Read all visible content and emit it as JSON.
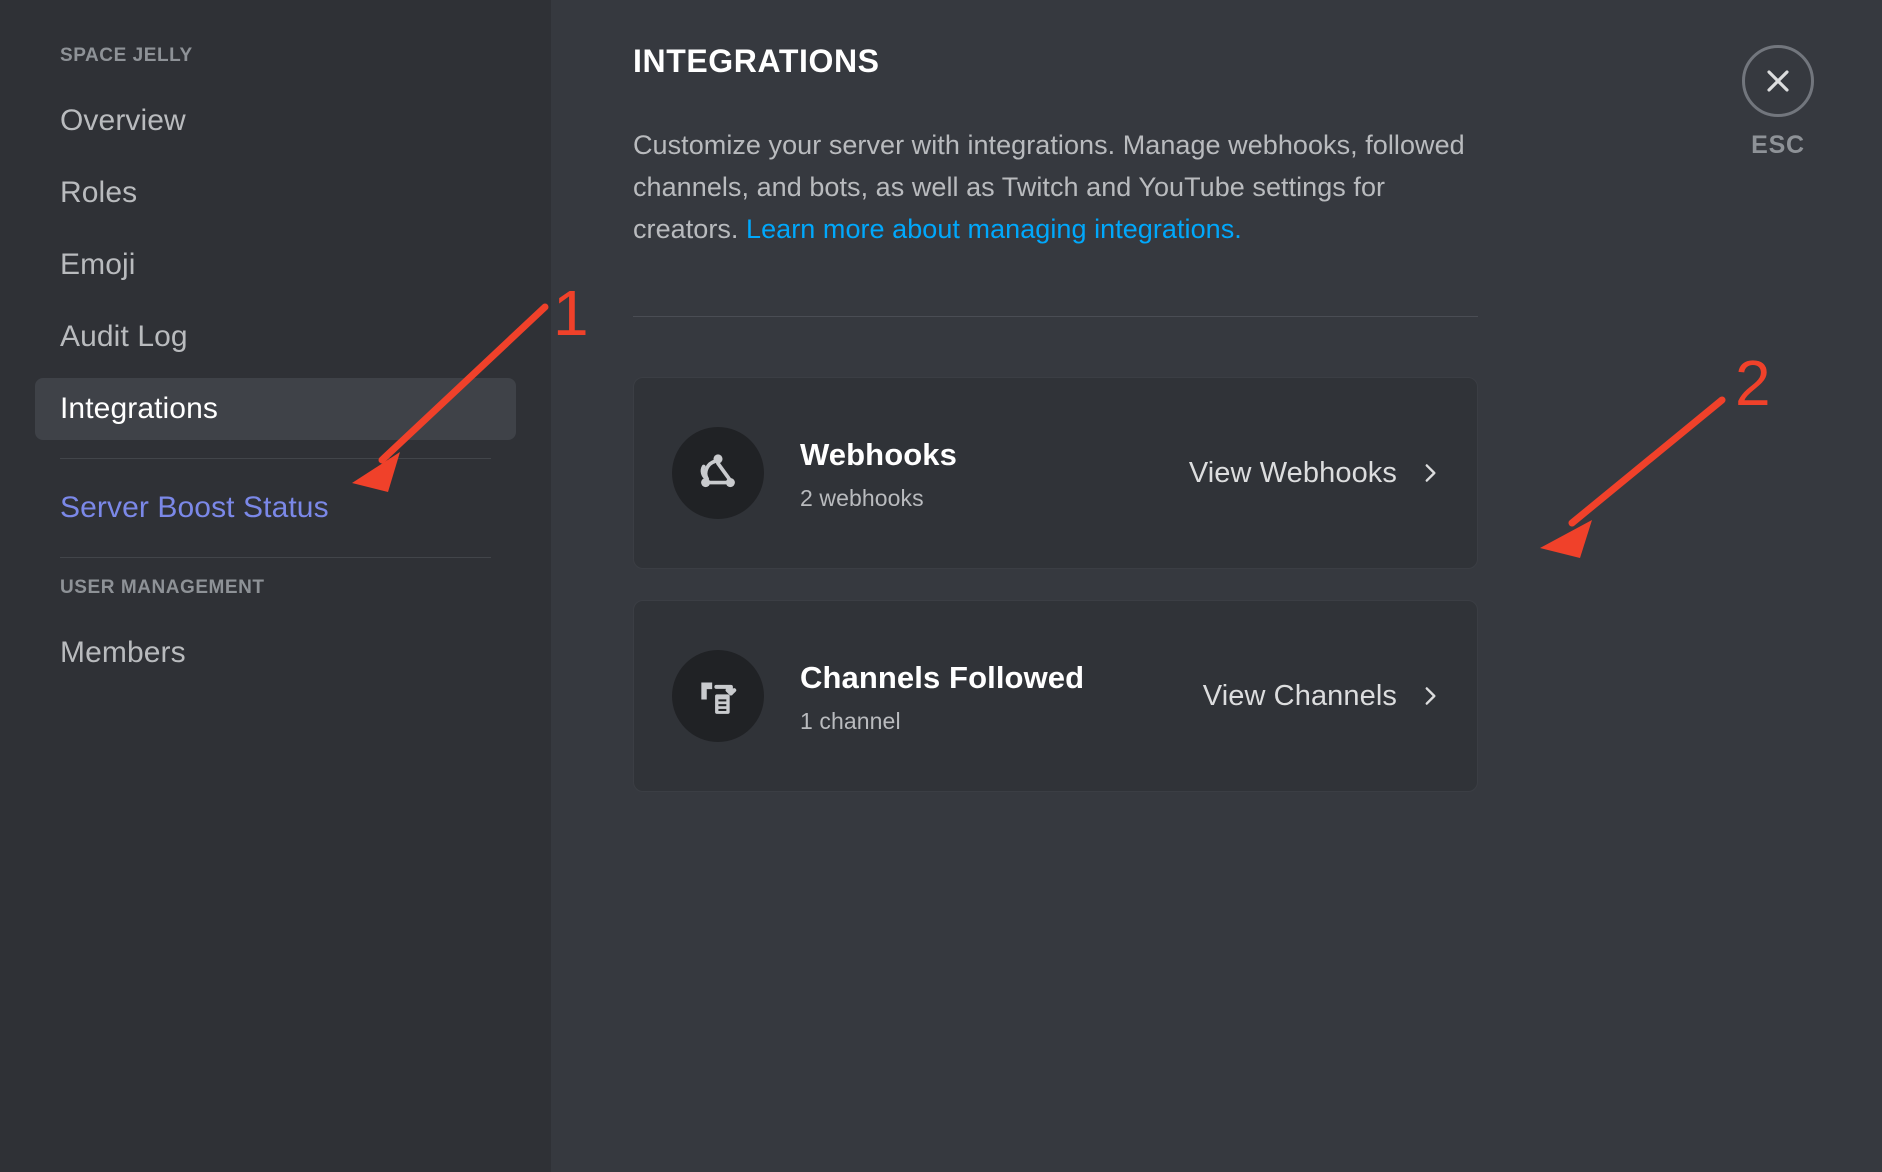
{
  "sidebar": {
    "server_name": "SPACE JELLY",
    "items": [
      {
        "label": "Overview",
        "active": false
      },
      {
        "label": "Roles",
        "active": false
      },
      {
        "label": "Emoji",
        "active": false
      },
      {
        "label": "Audit Log",
        "active": false
      },
      {
        "label": "Integrations",
        "active": true
      }
    ],
    "boost_label": "Server Boost Status",
    "user_management_header": "USER MANAGEMENT",
    "members_label": "Members"
  },
  "main": {
    "title": "INTEGRATIONS",
    "description_part1": "Customize your server with integrations. Manage webhooks, followed channels, and bots, as well as Twitch and YouTube settings for creators. ",
    "description_link": "Learn more about managing integrations.",
    "cards": [
      {
        "icon": "webhook-icon",
        "title": "Webhooks",
        "subtitle": "2 webhooks",
        "action": "View Webhooks"
      },
      {
        "icon": "followed-channels-icon",
        "title": "Channels Followed",
        "subtitle": "1 channel",
        "action": "View Channels"
      }
    ]
  },
  "close": {
    "label": "ESC",
    "icon": "close-icon"
  },
  "annotations": [
    {
      "number": "1"
    },
    {
      "number": "2"
    }
  ],
  "colors": {
    "sidebar_bg": "#2f3136",
    "main_bg": "#36393f",
    "card_bg": "#303338",
    "accent_link": "#00a8fc",
    "boost_purple": "#7b88e8",
    "annotation_red": "#f0412a",
    "active_item_bg": "#3f4248"
  }
}
